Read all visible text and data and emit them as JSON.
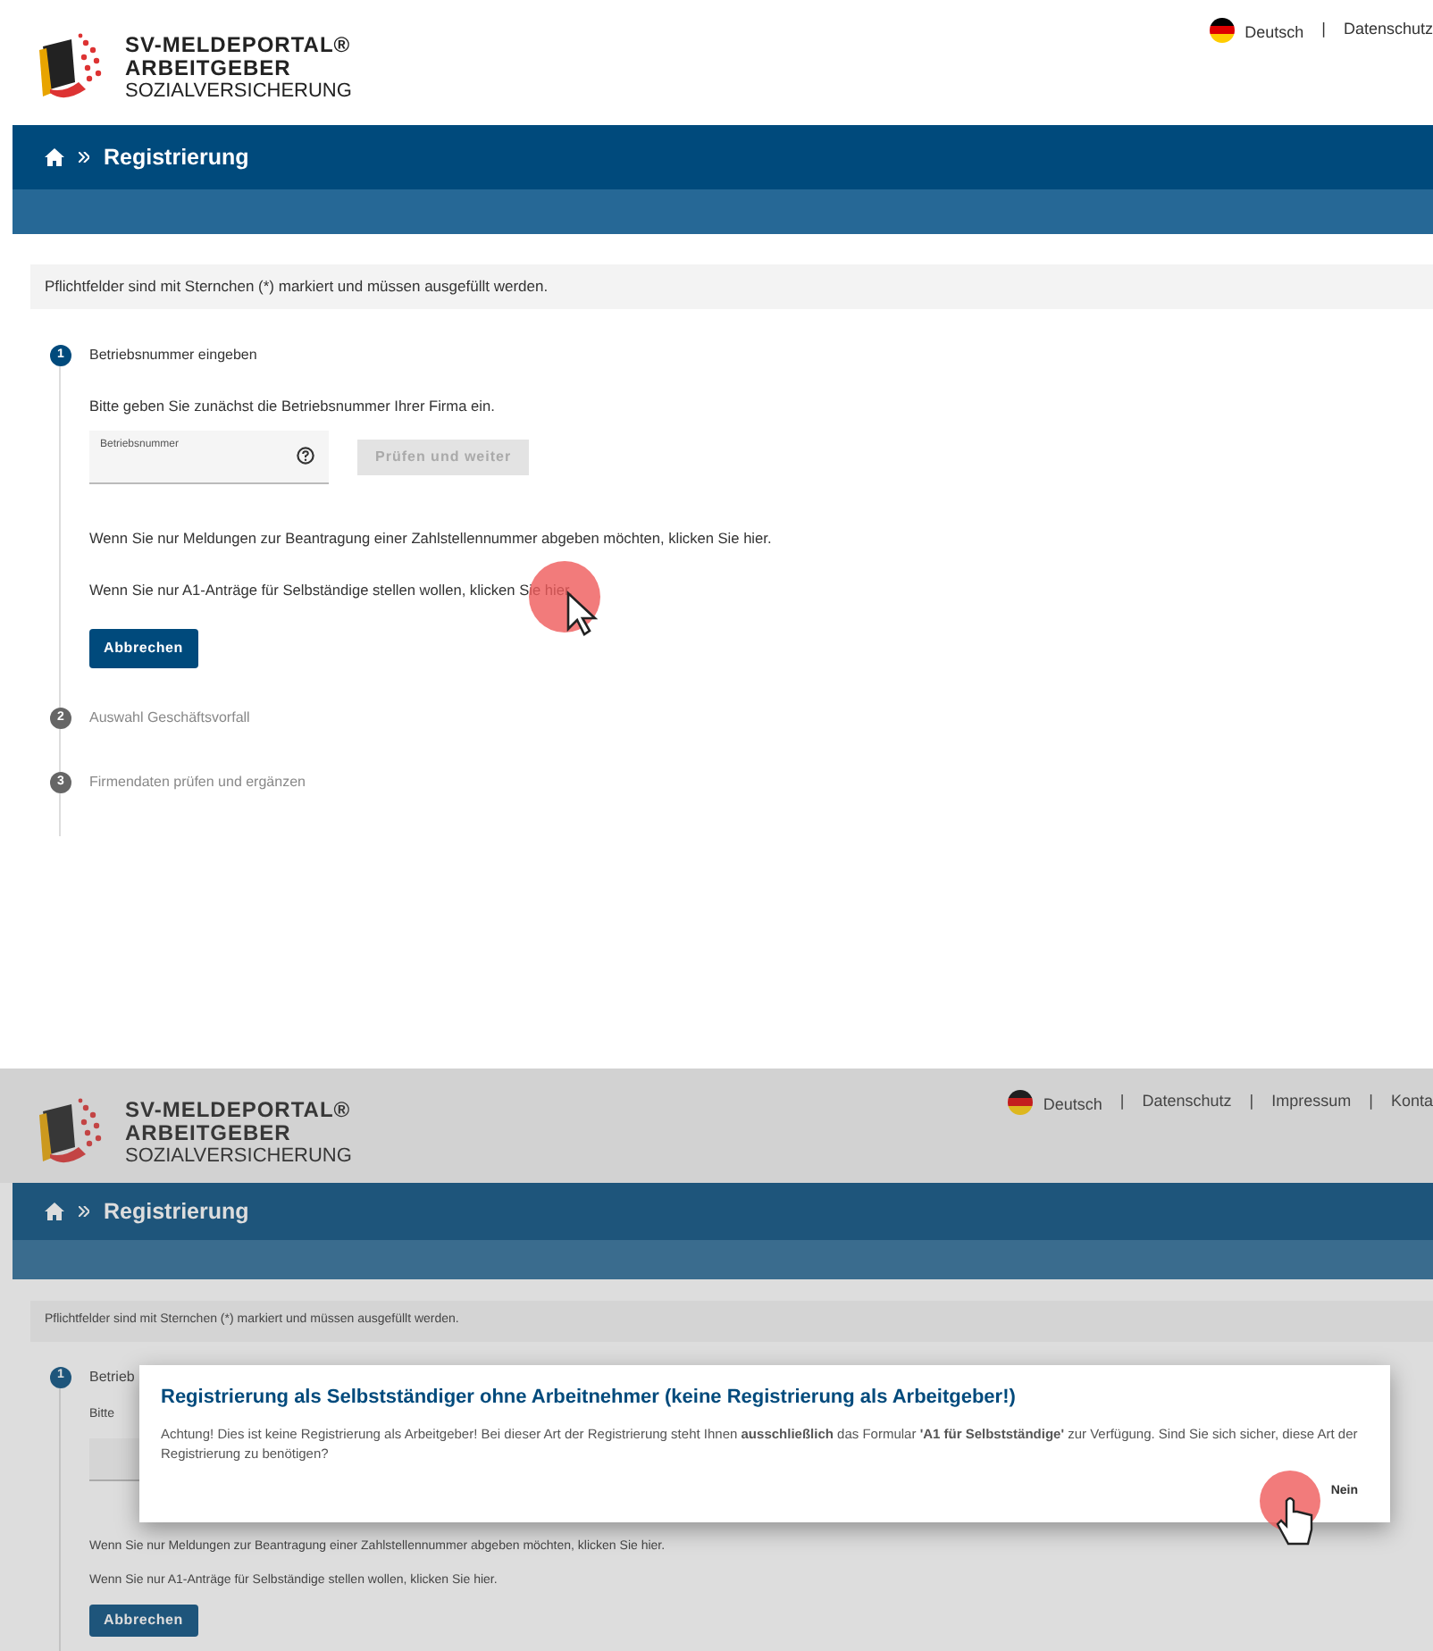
{
  "frames": [
    {
      "dimmed": false,
      "cursor": {
        "kind": "arrow"
      },
      "header": {
        "logo": {
          "line1": "SV-MELDEPORTAL®",
          "line2": "ARBEITGEBER",
          "line3": "SOZIALVERSICHERUNG"
        },
        "language": "Deutsch",
        "links": [
          {
            "separator": "|",
            "label": "Datenschutz"
          }
        ]
      },
      "breadcrumb": "Registrierung",
      "notice": "Pflichtfelder sind mit Sternchen (*) markiert und müssen ausgefüllt werden.",
      "steps": [
        {
          "number": "1",
          "label": "Betriebsnummer eingeben",
          "active": true,
          "intro": "Bitte geben Sie zunächst die Betriebsnummer Ihrer Firma ein.",
          "field_label": "Betriebsnummer",
          "submit": {
            "label": "Prüfen und weiter",
            "disabled": true
          },
          "hints": [
            {
              "text": "Wenn Sie nur Meldungen zur Beantragung einer Zahlstellennummer abgeben möchten, klicken Sie",
              "link": "hier",
              "after": "."
            },
            {
              "text": "Wenn Sie nur A1-Anträge für Selbständige stellen wollen, klicken Sie",
              "link": "hier",
              "after": "."
            }
          ],
          "cancel": "Abbrechen"
        },
        {
          "number": "2",
          "label": "Auswahl Geschäftsvorfall",
          "active": false
        },
        {
          "number": "3",
          "label": "Firmendaten prüfen und ergänzen",
          "active": false
        }
      ]
    },
    {
      "dimmed": true,
      "cursor": {
        "kind": "hand"
      },
      "header": {
        "logo": {
          "line1": "SV-MELDEPORTAL®",
          "line2": "ARBEITGEBER",
          "line3": "SOZIALVERSICHERUNG"
        },
        "language": "Deutsch",
        "links": [
          {
            "separator": "|",
            "label": "Datenschutz"
          },
          {
            "separator": "|",
            "label": "Impressum"
          },
          {
            "separator": "|",
            "label": "Konta"
          }
        ]
      },
      "breadcrumb": "Registrierung",
      "notice": "Pflichtfelder sind mit Sternchen (*) markiert und müssen ausgefüllt werden.",
      "steps": [
        {
          "number": "1",
          "label": "Betrieb",
          "active": true,
          "intro": "Bitte",
          "hints": [
            {
              "text": "Wenn Sie nur Meldungen zur Beantragung einer Zahlstellennummer abgeben möchten, klicken Sie",
              "link": "hier",
              "after": "."
            },
            {
              "text": "Wenn Sie nur A1-Anträge für Selbständige stellen wollen, klicken Sie",
              "link": "hier",
              "after": "."
            }
          ],
          "cancel": "Abbrechen"
        }
      ],
      "dialog": {
        "title": "Registrierung als Selbstständiger ohne Arbeitnehmer (keine Registrierung als Arbeitgeber!)",
        "body": "Achtung! Dies ist keine Registrierung als Arbeitgeber! Bei dieser Art der Registrierung steht Ihnen **ausschließlich** das Formular **'A1 für Selbstständige'** zur Verfügung. Sind Sie sich sicher, diese Art der Registrierung zu benötigen?",
        "buttons": [
          "Nein"
        ]
      }
    }
  ]
}
